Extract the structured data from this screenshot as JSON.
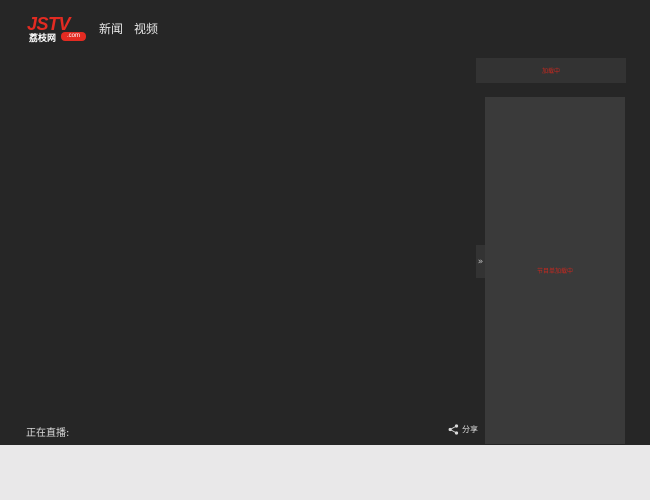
{
  "header": {
    "logo": {
      "brand": "JSTV",
      "chinese": "荔枝网",
      "domain": ".com"
    },
    "nav": [
      {
        "label": "新闻"
      },
      {
        "label": "视频"
      }
    ]
  },
  "player": {
    "now_playing_label": "正在直播:",
    "share_label": "分享"
  },
  "sidebar": {
    "top_text": "加载中",
    "panel_text": "节目单加载中",
    "collapse_icon": "»"
  },
  "colors": {
    "background": "#262626",
    "accent_red": "#e32b22",
    "panel": "#3a3a3a",
    "footer": "#e9e8e9"
  }
}
